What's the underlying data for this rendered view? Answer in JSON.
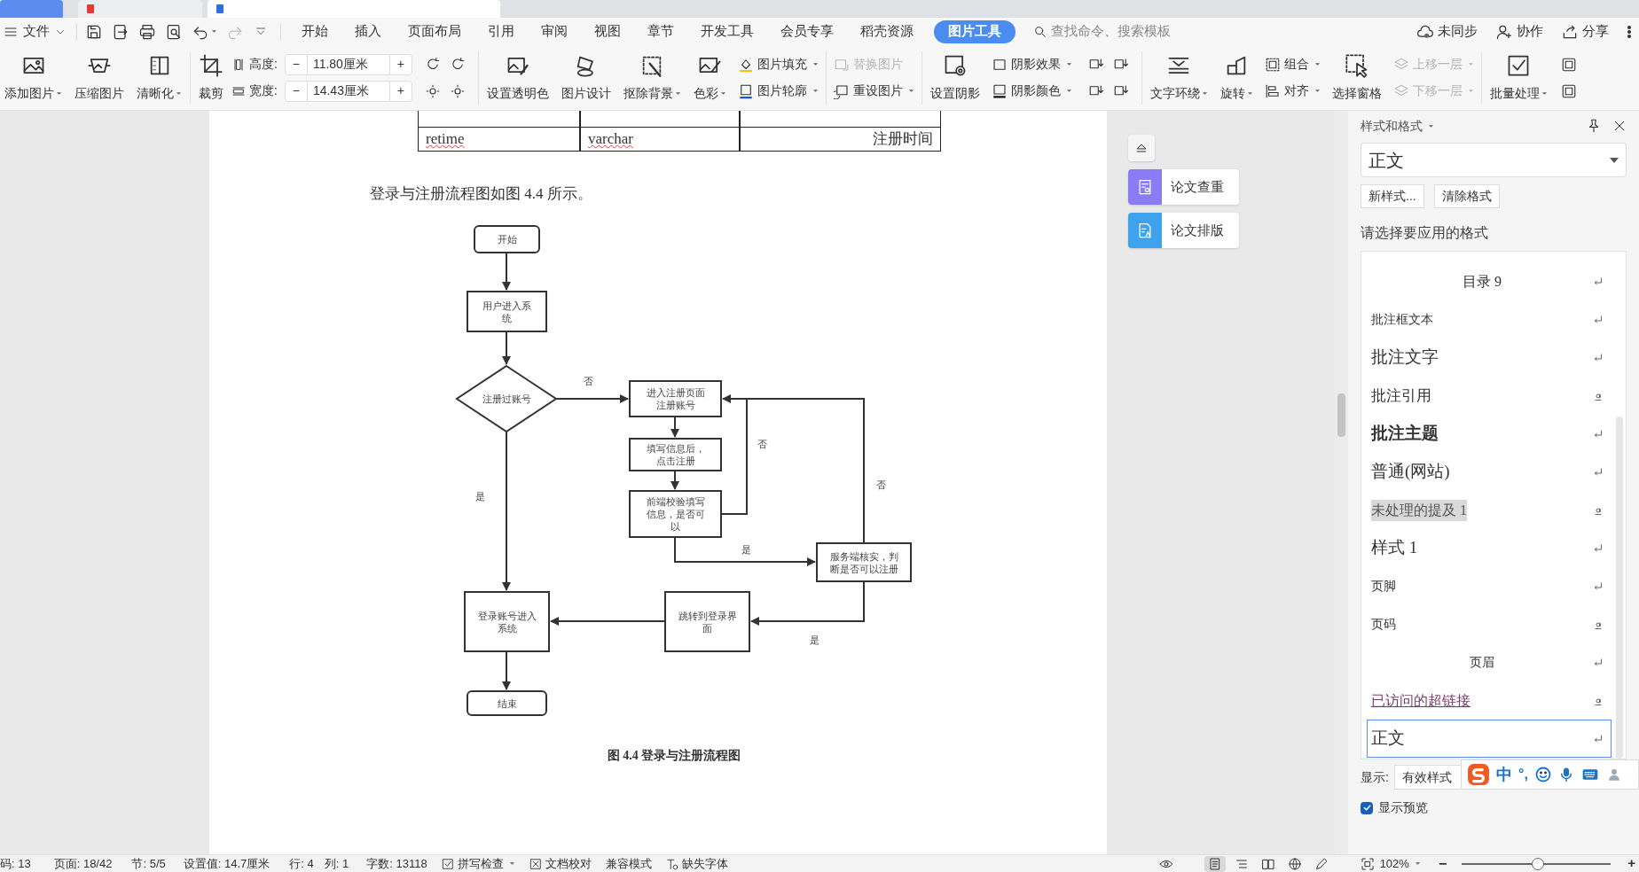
{
  "doc_tabs": [
    {
      "selected": false,
      "kind": "home"
    },
    {
      "selected": false,
      "kind": "red"
    },
    {
      "selected": true,
      "kind": "blue"
    }
  ],
  "menu": {
    "file": "文件",
    "tabs": [
      {
        "label": "开始",
        "selected": false
      },
      {
        "label": "插入",
        "selected": false
      },
      {
        "label": "页面布局",
        "selected": false
      },
      {
        "label": "引用",
        "selected": false
      },
      {
        "label": "审阅",
        "selected": false
      },
      {
        "label": "视图",
        "selected": false
      },
      {
        "label": "章节",
        "selected": false
      },
      {
        "label": "开发工具",
        "selected": false
      },
      {
        "label": "会员专享",
        "selected": false
      },
      {
        "label": "稻壳资源",
        "selected": false
      },
      {
        "label": "图片工具",
        "selected": true
      }
    ],
    "search": {
      "placeholder": "查找命令、搜索模板"
    },
    "actions": [
      "未同步",
      "协作",
      "分享"
    ]
  },
  "ribbon": [
    [
      {
        "kind": "large",
        "label": "添加图片",
        "caret": true
      },
      {
        "kind": "large",
        "label": "压缩图片",
        "caret": false
      },
      {
        "kind": "large",
        "label": "清晰化",
        "caret": true
      }
    ],
    [
      {
        "kind": "large",
        "label": "裁剪",
        "caret": false
      },
      {
        "kind": "size",
        "fields": [
          {
            "label": "高度:",
            "value": "11.80厘米",
            "dec": "−",
            "inc": "+"
          },
          {
            "label": "宽度:",
            "value": "14.43厘米",
            "dec": "−",
            "inc": "+"
          }
        ]
      },
      {
        "kind": "icon_grid"
      }
    ],
    [
      {
        "kind": "large",
        "label": "设置透明色",
        "caret": false
      },
      {
        "kind": "large",
        "label": "图片设计",
        "caret": false
      },
      {
        "kind": "large",
        "label": "抠除背景",
        "caret": true
      },
      {
        "kind": "large",
        "label": "色彩",
        "caret": true
      },
      {
        "kind": "stack",
        "items": [
          {
            "label": "图片填充",
            "caret": true,
            "disabled": false
          },
          {
            "label": "图片轮廓",
            "caret": true,
            "disabled": false
          }
        ]
      }
    ],
    [
      {
        "kind": "stack",
        "items": [
          {
            "label": "替换图片",
            "caret": false,
            "disabled": true
          },
          {
            "label": "重设图片",
            "caret": true,
            "disabled": false
          }
        ]
      }
    ],
    [
      {
        "kind": "large",
        "label": "设置阴影",
        "caret": false
      },
      {
        "kind": "stack",
        "items": [
          {
            "label": "阴影效果",
            "caret": true,
            "disabled": false
          },
          {
            "label": "阴影颜色",
            "caret": true,
            "disabled": false
          }
        ]
      },
      {
        "kind": "icon_grid"
      }
    ],
    [
      {
        "kind": "large",
        "label": "文字环绕",
        "caret": true
      },
      {
        "kind": "large",
        "label": "旋转",
        "caret": true
      },
      {
        "kind": "stack",
        "items": [
          {
            "label": "组合",
            "caret": true,
            "disabled": false
          },
          {
            "label": "对齐",
            "caret": true,
            "disabled": false
          }
        ]
      },
      {
        "kind": "large",
        "label": "选择窗格",
        "caret": false
      },
      {
        "kind": "stack",
        "items": [
          {
            "label": "上移一层",
            "caret": true,
            "disabled": true
          },
          {
            "label": "下移一层",
            "caret": true,
            "disabled": true
          }
        ]
      }
    ],
    [
      {
        "kind": "large",
        "label": "批量处理",
        "caret": true
      },
      {
        "kind": "icon_pair"
      }
    ]
  ],
  "document": {
    "table_row": [
      {
        "text": "retime",
        "misspelled": true
      },
      {
        "text": "varchar",
        "misspelled": true
      },
      {
        "text": "注册时间",
        "misspelled": false
      }
    ],
    "paragraph": "登录与注册流程图如图 4.4 所示。",
    "flowchart": {
      "nodes": [
        {
          "kind": "terminal",
          "lines": [
            "开始"
          ]
        },
        {
          "kind": "process",
          "lines": [
            "用户进入系",
            "统"
          ]
        },
        {
          "kind": "decision",
          "lines": [
            "注册过账号"
          ]
        },
        {
          "kind": "process",
          "lines": [
            "进入注册页面",
            "注册账号"
          ]
        },
        {
          "kind": "process",
          "lines": [
            "填写信息后，",
            "点击注册"
          ]
        },
        {
          "kind": "process",
          "lines": [
            "前端校验填写",
            "信息，是否可",
            "以"
          ]
        },
        {
          "kind": "process",
          "lines": [
            "服务端核实，判",
            "断是否可以注册"
          ]
        },
        {
          "kind": "process",
          "lines": [
            "登录账号进入",
            "系统"
          ]
        },
        {
          "kind": "process",
          "lines": [
            "跳转到登录界",
            "面"
          ]
        },
        {
          "kind": "terminal",
          "lines": [
            "结束"
          ]
        }
      ],
      "edge_labels": [
        "否",
        "否",
        "否",
        "是",
        "是",
        "是"
      ]
    },
    "caption": "图 4.4  登录与注册流程图"
  },
  "side_tools": [
    "论文查重",
    "论文排版"
  ],
  "styles_panel": {
    "title": "样式和格式",
    "current": "正文",
    "buttons": [
      "新样式...",
      "清除格式"
    ],
    "prompt": "请选择要应用的格式",
    "items": [
      {
        "label": "目录 9",
        "kind": "toc",
        "char_style": false,
        "selected": false
      },
      {
        "label": "批注框文本",
        "kind": "small",
        "char_style": false,
        "selected": false
      },
      {
        "label": "批注文字",
        "kind": "large",
        "char_style": false,
        "selected": false
      },
      {
        "label": "批注引用",
        "kind": "medium",
        "char_style": true,
        "selected": false
      },
      {
        "label": "批注主题",
        "kind": "bold",
        "char_style": false,
        "selected": false
      },
      {
        "label": "普通(网站)",
        "kind": "large",
        "char_style": false,
        "selected": false
      },
      {
        "label": "未处理的提及 1",
        "kind": "highlight",
        "char_style": true,
        "selected": false
      },
      {
        "label": "样式 1",
        "kind": "large",
        "char_style": false,
        "selected": false
      },
      {
        "label": "页脚",
        "kind": "small",
        "char_style": false,
        "selected": false
      },
      {
        "label": "页码",
        "kind": "small",
        "char_style": true,
        "selected": false
      },
      {
        "label": "页眉",
        "kind": "centered",
        "char_style": false,
        "selected": false
      },
      {
        "label": "已访问的超链接",
        "kind": "link",
        "char_style": true,
        "selected": false
      },
      {
        "label": "正文",
        "kind": "large",
        "char_style": false,
        "selected": true
      }
    ],
    "show_label": "显示:",
    "show_value": "有效样式",
    "preview_label": "显示预览",
    "preview_checked": true
  },
  "ime": {
    "mode": "中",
    "punct": "°,"
  },
  "status_bar": {
    "items": [
      {
        "text": "码: 13",
        "kind": "plain"
      },
      {
        "text": "页面: 18/42",
        "kind": "plain"
      },
      {
        "text": "节: 5/5",
        "kind": "plain"
      },
      {
        "text": "设置值: 14.7厘米",
        "kind": "plain"
      },
      {
        "text": "行: 4",
        "kind": "plain"
      },
      {
        "text": "列: 1",
        "kind": "plain"
      },
      {
        "text": "字数: 13118",
        "kind": "plain"
      },
      {
        "text": "拼写检查",
        "kind": "spell"
      },
      {
        "text": "文档校对",
        "kind": "proof"
      },
      {
        "text": "兼容模式",
        "kind": "plain"
      },
      {
        "text": "缺失字体",
        "kind": "font"
      }
    ],
    "views": [
      {
        "selected": true
      },
      {
        "selected": false
      },
      {
        "selected": false
      },
      {
        "selected": false
      }
    ],
    "zoom": "102%",
    "zoom_out": "−",
    "zoom_in": "+",
    "level": 0.51
  }
}
